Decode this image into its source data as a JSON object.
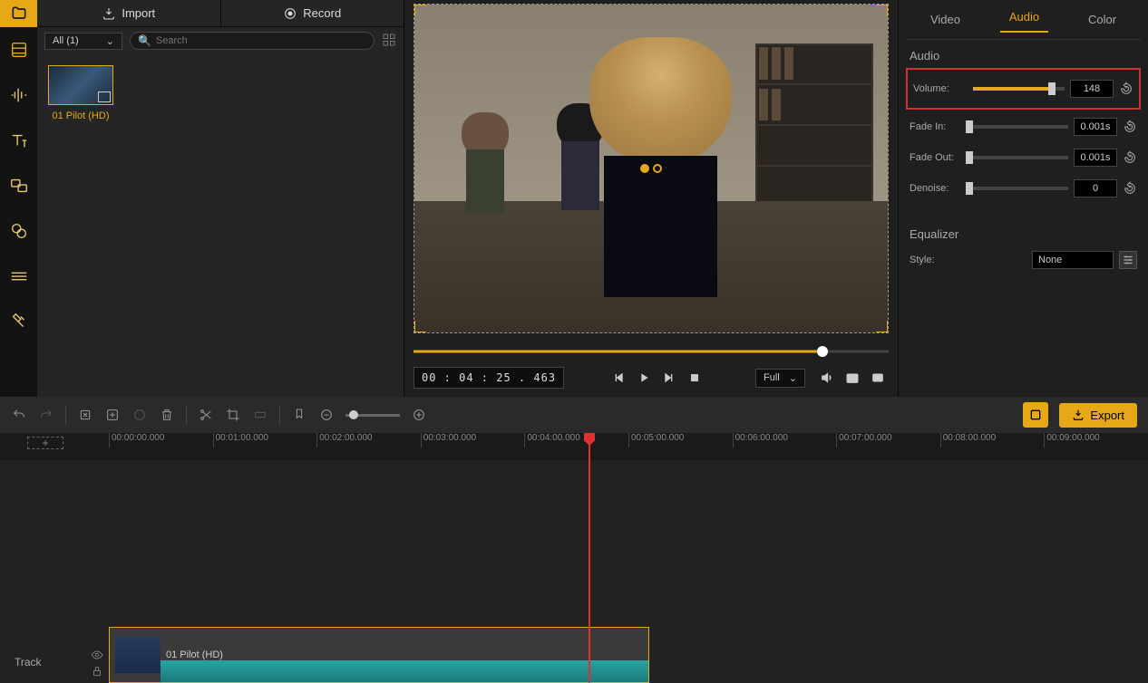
{
  "topbar": {
    "import": "Import",
    "record": "Record"
  },
  "media": {
    "filter": "All (1)",
    "search_placeholder": "Search",
    "thumb_label": "01 Pilot (HD)"
  },
  "preview": {
    "timecode": "00 : 04 : 25 . 463",
    "aspect": "Full"
  },
  "right": {
    "tabs": [
      "Video",
      "Audio",
      "Color"
    ],
    "active": "Audio",
    "section_audio": "Audio",
    "section_eq": "Equalizer",
    "volume": {
      "label": "Volume:",
      "value": "148",
      "pct": 86
    },
    "fadein": {
      "label": "Fade In:",
      "value": "0.001s",
      "pct": 0
    },
    "fadeout": {
      "label": "Fade Out:",
      "value": "0.001s",
      "pct": 0
    },
    "denoise": {
      "label": "Denoise:",
      "value": "0",
      "pct": 0
    },
    "eqstyle": {
      "label": "Style:",
      "value": "None"
    }
  },
  "toolbar": {
    "export": "Export"
  },
  "timeline": {
    "ticks": [
      "00:00:00.000",
      "00:01:00.000",
      "00:02:00.000",
      "00:03:00.000",
      "00:04:00.000",
      "00:05:00.000",
      "00:06:00.000",
      "00:07:00.000",
      "00:08:00.000",
      "00:09:00.000"
    ],
    "track": "Track",
    "clip": "01 Pilot (HD)"
  }
}
